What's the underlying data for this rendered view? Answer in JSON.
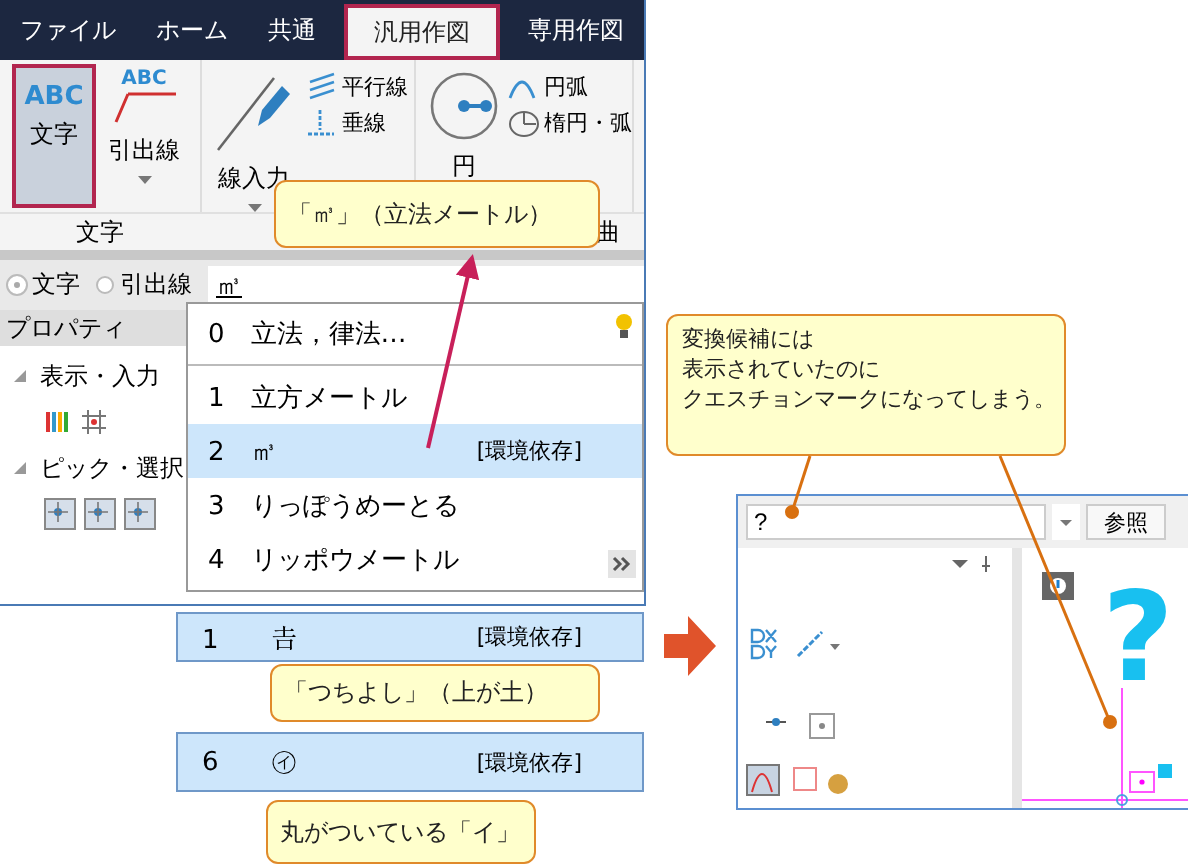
{
  "ribbon": {
    "tabs": [
      {
        "label": "ファイル",
        "selected": false
      },
      {
        "label": "ホーム",
        "selected": false
      },
      {
        "label": "共通",
        "selected": false
      },
      {
        "label": "汎用作図",
        "selected": true
      },
      {
        "label": "専用作図",
        "selected": false
      }
    ],
    "large_buttons": [
      {
        "label": "文字",
        "kind": "abc",
        "icon_text": "ABC",
        "selected": true
      },
      {
        "label": "引出線",
        "kind": "leader",
        "icon_text": "ABC",
        "selected": false
      },
      {
        "label": "線入力",
        "kind": "pen",
        "selected": false
      }
    ],
    "small_buttons": [
      {
        "label": "平行線",
        "kind": "parallel"
      },
      {
        "label": "垂線",
        "kind": "perp"
      }
    ],
    "circle_button": {
      "label": "円"
    },
    "arc_buttons": [
      {
        "label": "円弧",
        "kind": "arc"
      },
      {
        "label": "楕円・弧",
        "kind": "ellipse"
      }
    ],
    "group_labels": [
      "文字",
      "曲"
    ]
  },
  "input_bar": {
    "radios": [
      {
        "label": "文字",
        "selected": true
      },
      {
        "label": "引出線",
        "selected": false
      }
    ],
    "value": "㎥"
  },
  "properties": {
    "title": "プロパティ",
    "sections": [
      {
        "label": "表示・入力",
        "expanded": true
      },
      {
        "label": "ピック・選択",
        "expanded": true
      }
    ]
  },
  "candidates": [
    {
      "number": "0",
      "text": "立法，律法…",
      "selected": false
    },
    {
      "number": "1",
      "text": "立方メートル",
      "selected": false
    },
    {
      "number": "2",
      "text": "㎥",
      "tag": "[環境依存]",
      "selected": true
    },
    {
      "number": "3",
      "text": "りっぽうめーとる",
      "selected": false
    },
    {
      "number": "4",
      "text": "リッポウメートル",
      "selected": false
    }
  ],
  "callouts": [
    {
      "lines": [
        "「㎥」（立法メートル）"
      ]
    },
    {
      "lines": [
        "「つちよし」（上が土）"
      ]
    },
    {
      "lines": [
        "丸がついている「イ」"
      ]
    },
    {
      "lines": [
        "変換候補には",
        "表示されていたのに",
        "クエスチョンマークになってしまう。"
      ]
    }
  ],
  "extra_candidates": [
    {
      "number": "1",
      "text": "𠮷",
      "tag": "[環境依存]"
    },
    {
      "number": "6",
      "text": "㋑",
      "tag": "[環境依存]"
    }
  ],
  "result_screen": {
    "value": "?",
    "button": "参照",
    "canvas_text": "?"
  }
}
